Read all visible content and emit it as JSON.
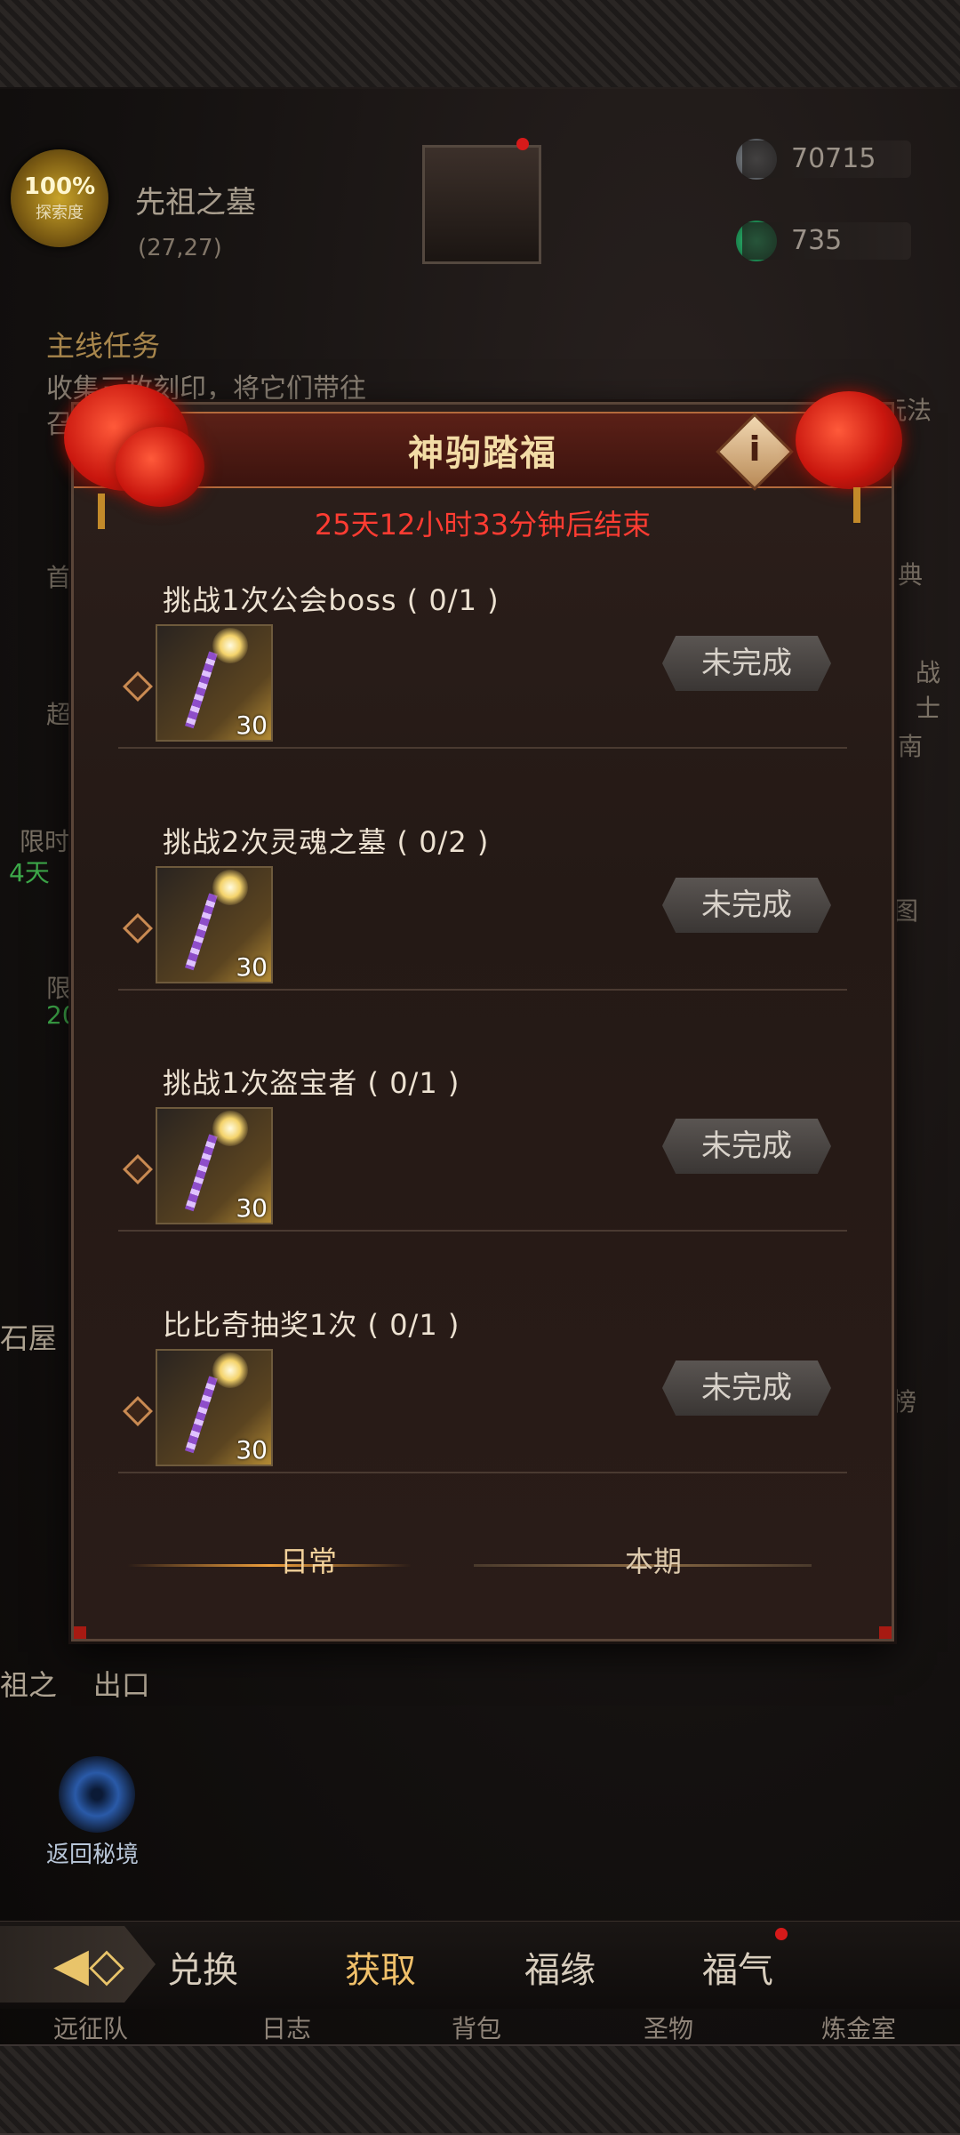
{
  "hud": {
    "explore_percent": "100%",
    "explore_label": "探索度",
    "location_name": "先祖之墓",
    "location_coord": "(27,27)",
    "resource1": "70715",
    "resource2": "735"
  },
  "quest": {
    "title": "主线任务",
    "desc": "收集三枚刻印，将它们带往",
    "desc2": "召"
  },
  "side_labels": {
    "gift": "玩法",
    "dian": "典",
    "zhan": "战士",
    "nan": "南",
    "tu": "图",
    "xianshi": "限时",
    "four_days": "4天",
    "xian": "限",
    "twenty": "20",
    "shou": "首",
    "chao": "超",
    "bang": "榜",
    "stone_house": "石屋",
    "exit": "祖之    出口"
  },
  "portal": {
    "label": "返回秘境"
  },
  "modal": {
    "title": "神驹踏福",
    "timer": "25天12小时33分钟后结束",
    "info_glyph": "i",
    "tasks": [
      {
        "title": "挑战1次公会boss ( 0/1 )",
        "count": "30",
        "status": "未完成"
      },
      {
        "title": "挑战2次灵魂之墓 ( 0/2 )",
        "count": "30",
        "status": "未完成"
      },
      {
        "title": "挑战1次盗宝者 ( 0/1 )",
        "count": "30",
        "status": "未完成"
      },
      {
        "title": "比比奇抽奖1次 ( 0/1 )",
        "count": "30",
        "status": "未完成"
      }
    ],
    "tab_daily": "日常",
    "tab_period": "本期"
  },
  "tabbar": {
    "arrow_icon": "◀◇",
    "tabs": [
      "兑换",
      "获取",
      "福缘",
      "福气"
    ],
    "active": "获取"
  },
  "nav": [
    "远征队",
    "日志",
    "背包",
    "圣物",
    "炼金室"
  ]
}
